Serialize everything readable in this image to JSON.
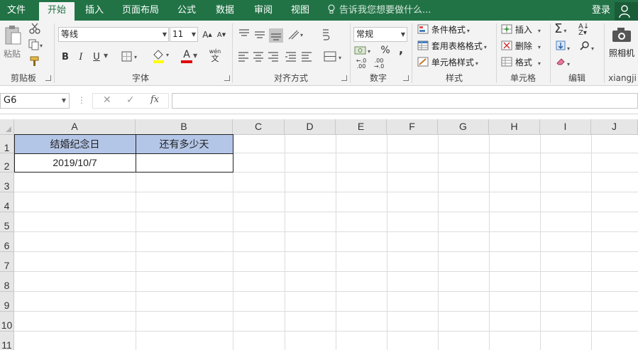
{
  "menu": {
    "tabs": [
      "文件",
      "开始",
      "插入",
      "页面布局",
      "公式",
      "数据",
      "审阅",
      "视图"
    ],
    "tell_me": "告诉我您想要做什么...",
    "login": "登录"
  },
  "ribbon": {
    "clipboard": {
      "paste": "粘贴",
      "label": "剪贴板"
    },
    "font": {
      "name": "等线",
      "size": "11",
      "bold": "B",
      "italic": "I",
      "underline": "U",
      "font_color_glyph": "A",
      "wen": "wén",
      "label": "字体"
    },
    "alignment": {
      "label": "对齐方式"
    },
    "number": {
      "format": "常规",
      "percent": "%",
      "comma": ",",
      "label": "数字"
    },
    "styles": {
      "conditional": "条件格式",
      "table_format": "套用表格格式",
      "cell_styles": "单元格样式",
      "label": "样式"
    },
    "cells": {
      "insert": "插入",
      "delete": "删除",
      "format": "格式",
      "label": "单元格"
    },
    "editing": {
      "sigma": "Σ",
      "label": "编辑"
    },
    "camera": {
      "label_top": "照相机",
      "label": "xiangji"
    }
  },
  "formula_bar": {
    "name_box": "G6",
    "fx": "fx",
    "content": ""
  },
  "grid": {
    "columns": [
      "A",
      "B",
      "C",
      "D",
      "E",
      "F",
      "G",
      "H",
      "I",
      "J"
    ],
    "rows": [
      "1",
      "2",
      "3",
      "4",
      "5",
      "6",
      "7",
      "8",
      "9",
      "10",
      "11"
    ],
    "cells": {
      "A1": "结婚纪念日",
      "B1": "还有多少天",
      "A2": "2019/10/7",
      "B2": ""
    }
  },
  "colors": {
    "excel_green": "#217346",
    "header_fill": "#b4c6e7"
  }
}
